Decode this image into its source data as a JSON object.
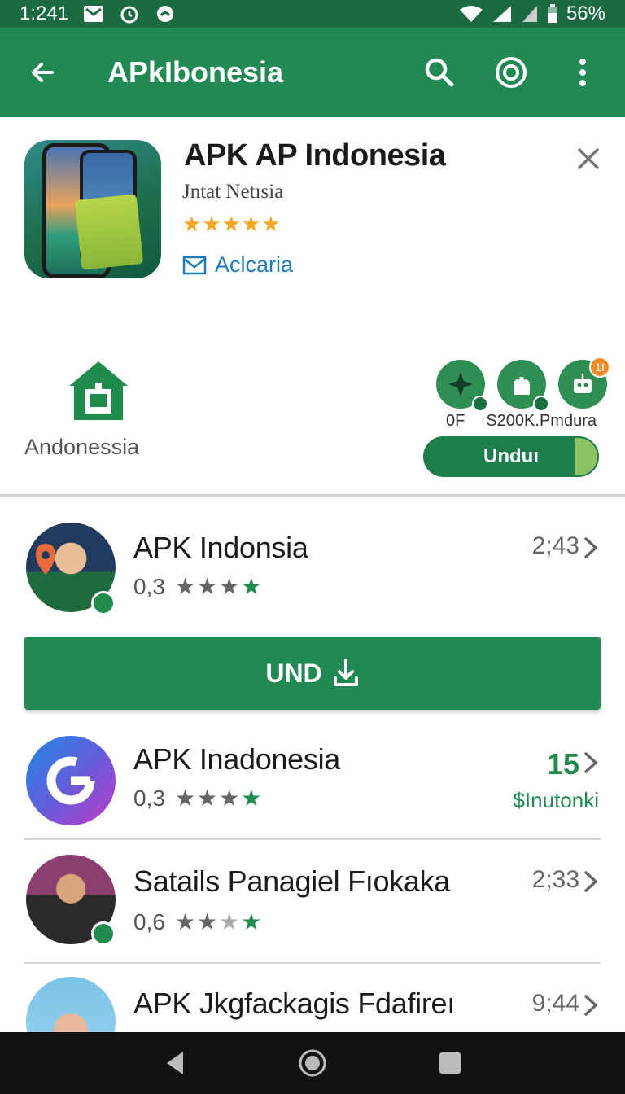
{
  "status_bar": {
    "time": "1:241",
    "battery": "56%"
  },
  "app_bar": {
    "title": "APkIbonesia"
  },
  "feature": {
    "title": "APK AP Indonesia",
    "subtitle": "Jntat Netısia",
    "rating_stars": "★★★★★",
    "link_label": "Aclcaria",
    "store_label": "Andonessia",
    "mini_labels": [
      "0F",
      "S200K.",
      "Pmdura"
    ],
    "mini_notification": "1I",
    "action_label": "Unduı"
  },
  "download_button": {
    "label": "UND"
  },
  "list": [
    {
      "title": "APK Indonsia",
      "rating": "0,3",
      "meta": "2;43"
    },
    {
      "title": "APK Inadonesia",
      "rating": "0,3",
      "meta": "15",
      "meta_sub": "$Inutonki"
    },
    {
      "title": "Satails Panagiel Fıokaka",
      "rating": "0,6",
      "meta": "2;33"
    },
    {
      "title": "APK Jkgfackagis Fdafireı",
      "rating": "",
      "meta": "9;44"
    }
  ],
  "colors": {
    "primary": "#218a54",
    "status_bar": "#1c6a42",
    "star_gold": "#f5a623",
    "link_blue": "#1e7ab8"
  }
}
